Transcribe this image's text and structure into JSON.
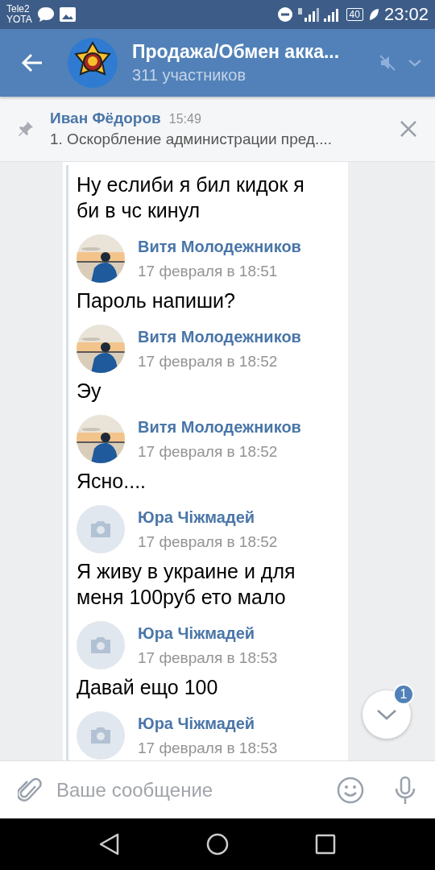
{
  "status_bar": {
    "carriers": [
      "Tele2",
      "YOTA"
    ],
    "battery": "40",
    "time": "23:02"
  },
  "header": {
    "title": "Продажа/Обмен акка...",
    "subtitle": "311 участников",
    "muted": true
  },
  "pinned": {
    "author": "Иван Фёдоров",
    "time": "15:49",
    "text": "1. Оскорбление администрации пред...."
  },
  "messages": [
    {
      "texts": [
        "Ну еслиби я бил кидок я би в чс кинул"
      ]
    },
    {
      "author": "Витя Молодежников",
      "date": "17 февраля в 18:51",
      "texts": [
        "Пароль напиши?"
      ]
    },
    {
      "author": "Витя Молодежников",
      "date": "17 февраля в 18:52",
      "texts": [
        "Эу"
      ]
    },
    {
      "author": "Витя Молодежников",
      "date": "17 февраля в 18:52",
      "texts": [
        "Ясно...."
      ]
    },
    {
      "author": "Юра Чіжмадей",
      "date": "17 февраля в 18:52",
      "kind": "camera",
      "texts": [
        "Я живу в украине и для меня 100руб ето мало"
      ]
    },
    {
      "author": "Юра Чіжмадей",
      "date": "17 февраля в 18:53",
      "kind": "camera",
      "texts": [
        "Давай ещо 100"
      ]
    },
    {
      "author": "Юра Чіжмадей",
      "date": "17 февраля в 18:53",
      "kind": "camera"
    }
  ],
  "scroll_button": {
    "badge": "1"
  },
  "composer": {
    "placeholder": "Ваше сообщение"
  }
}
